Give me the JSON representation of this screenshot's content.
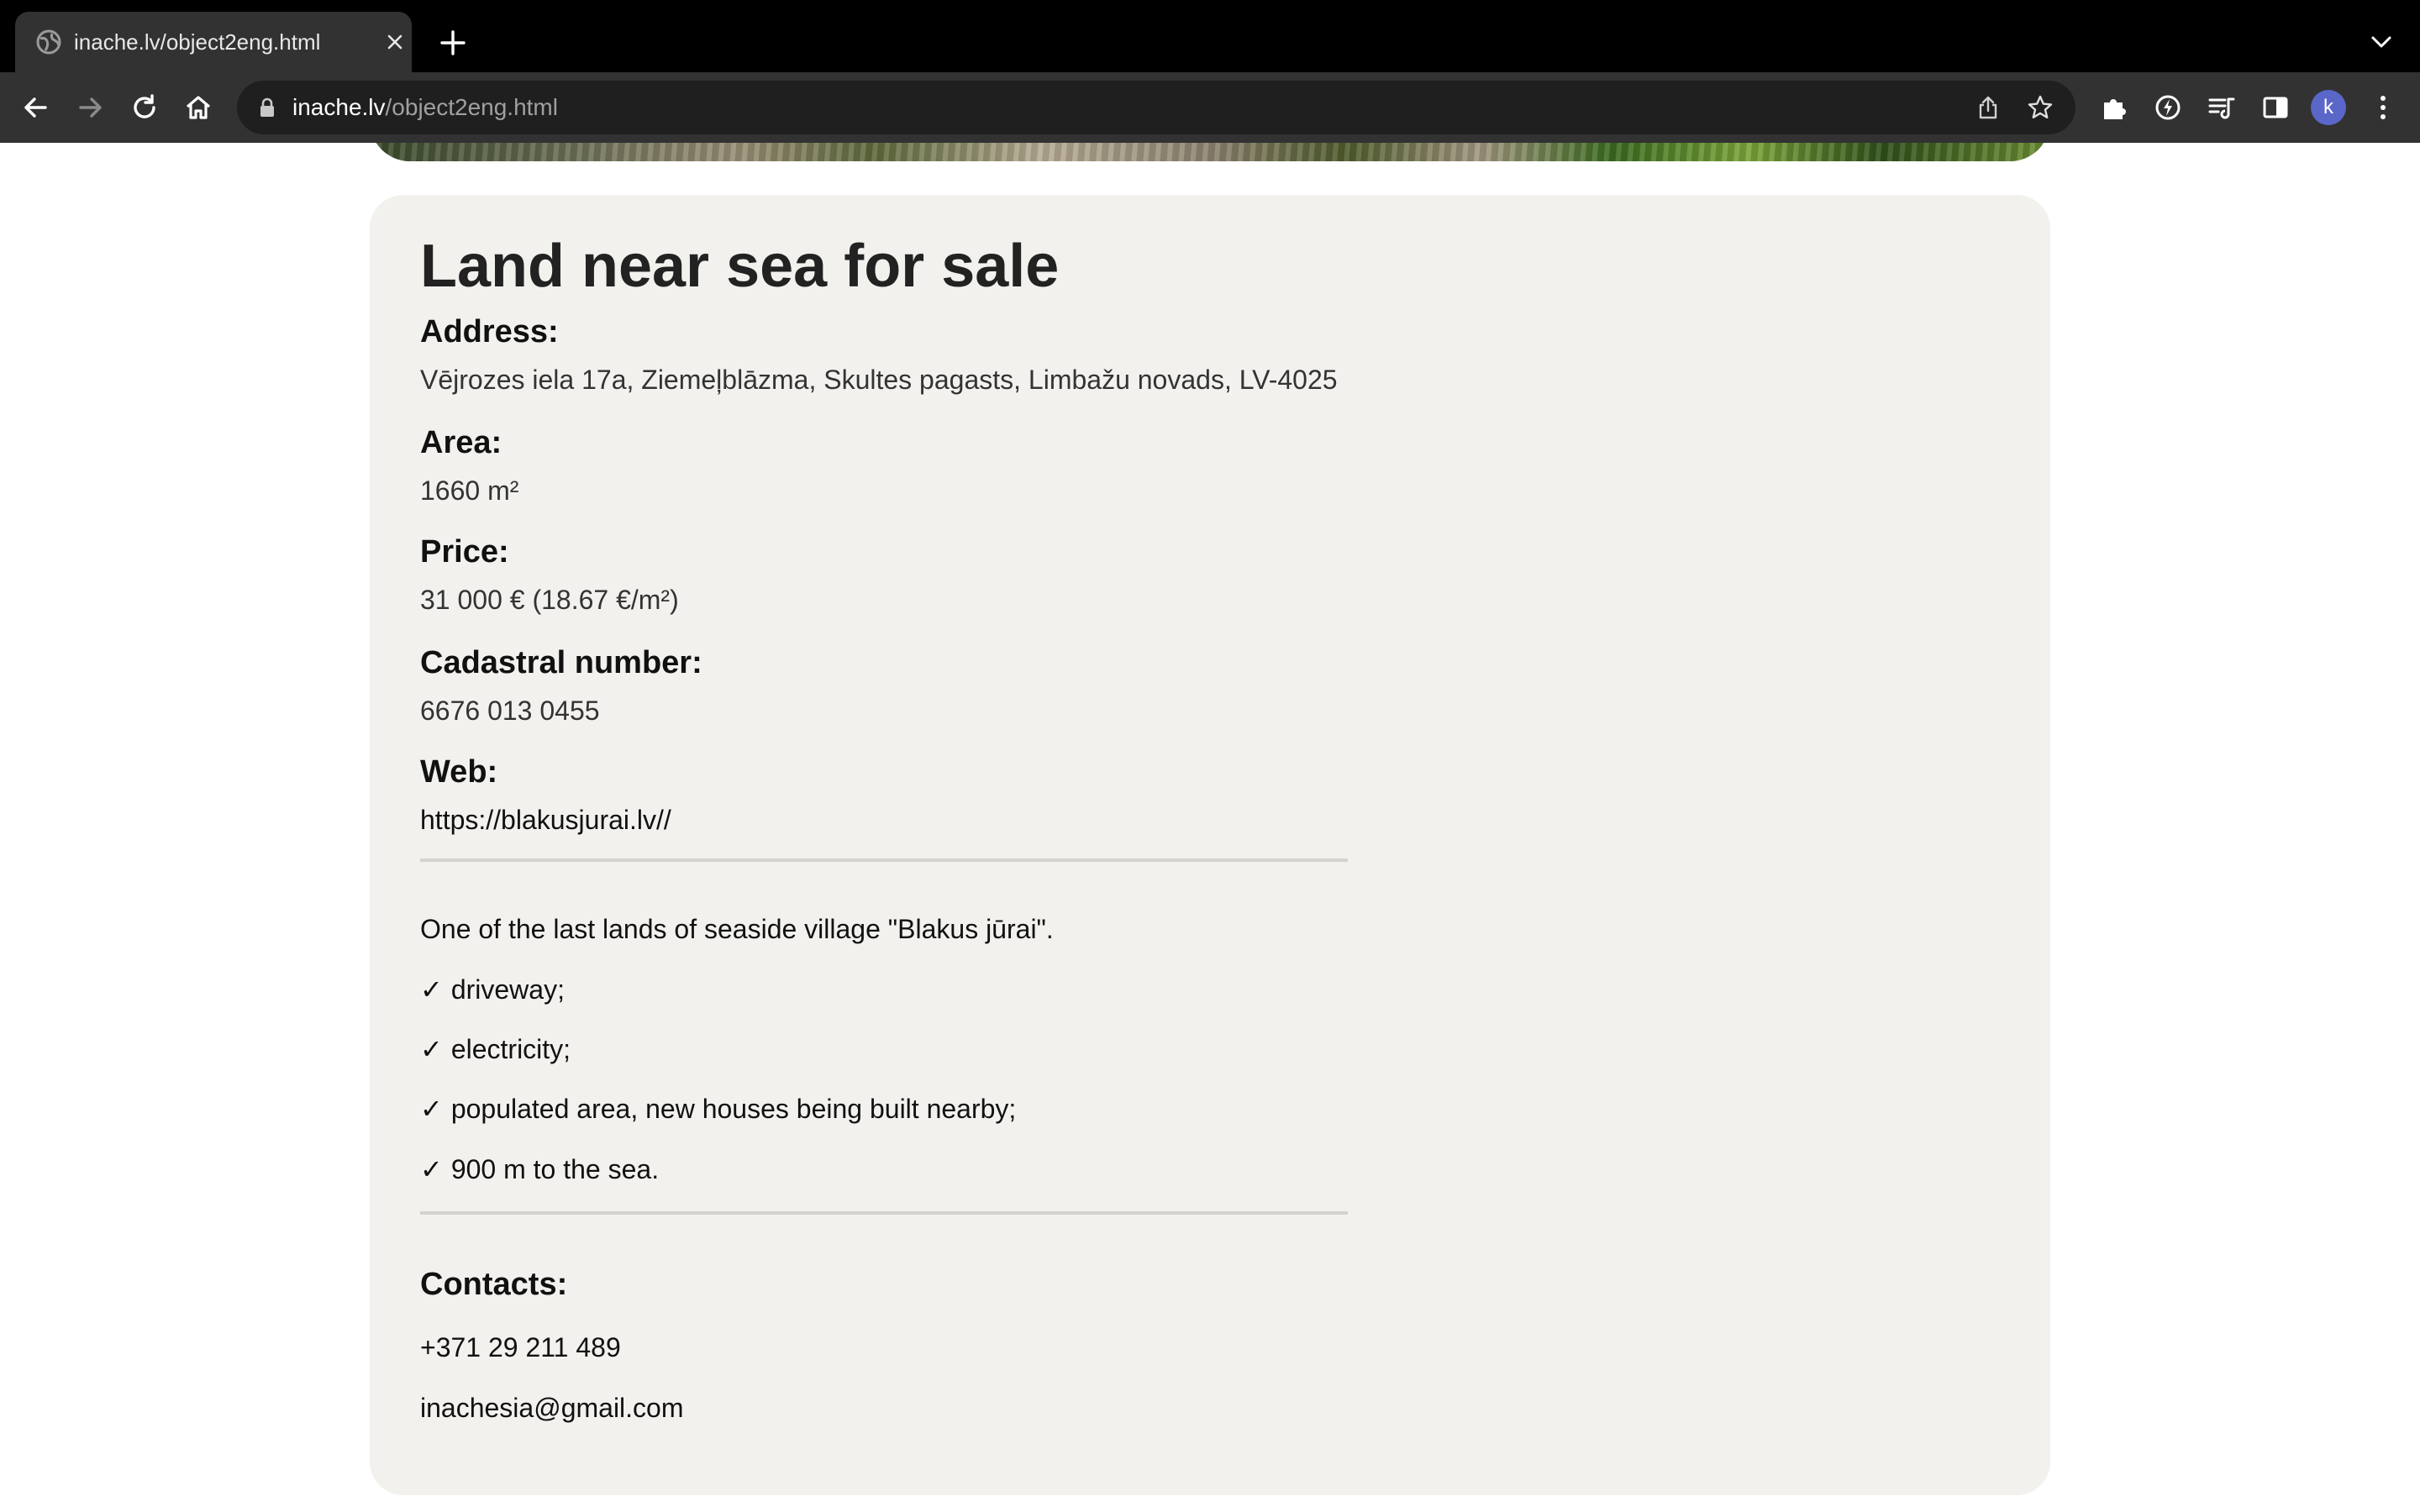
{
  "browser": {
    "tab_title": "inache.lv/object2eng.html",
    "url_host": "inache.lv",
    "url_path": "/object2eng.html",
    "profile_initial": "k",
    "accent_color": "#5a67c9"
  },
  "listing": {
    "title": "Land near sea for sale",
    "address_label": "Address:",
    "address_value": "Vējrozes iela 17a, Ziemeļblāzma, Skultes pagasts, Limbažu novads, LV-4025",
    "area_label": "Area:",
    "area_value": "1660 m²",
    "price_label": "Price:",
    "price_value": "31 000 € (18.67 €/m²)",
    "cadastral_label": "Cadastral number:",
    "cadastral_value": "6676 013 0455",
    "web_label": "Web:",
    "web_value": "https://blakusjurai.lv//",
    "description": "One of the last lands of seaside village \"Blakus jūrai\".",
    "check_glyph": "✓",
    "features": [
      "driveway;",
      "electricity;",
      "populated area, new houses being built nearby;",
      "900 m to the sea."
    ],
    "contacts_label": "Contacts:",
    "phone": "+371 29 211 489",
    "email": "inachesia@gmail.com"
  }
}
